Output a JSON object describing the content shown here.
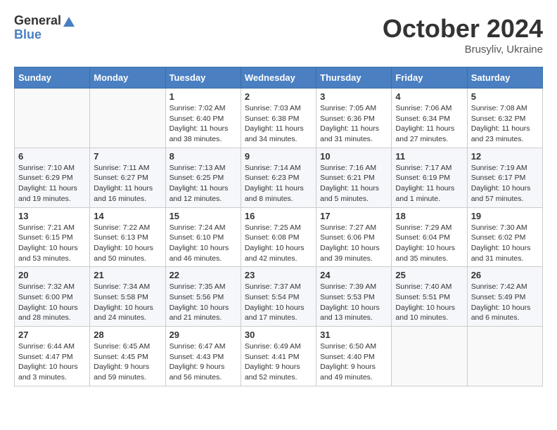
{
  "logo": {
    "general": "General",
    "blue": "Blue"
  },
  "title": {
    "month": "October 2024",
    "location": "Brusyliv, Ukraine"
  },
  "headers": [
    "Sunday",
    "Monday",
    "Tuesday",
    "Wednesday",
    "Thursday",
    "Friday",
    "Saturday"
  ],
  "weeks": [
    [
      {
        "day": "",
        "info": ""
      },
      {
        "day": "",
        "info": ""
      },
      {
        "day": "1",
        "info": "Sunrise: 7:02 AM\nSunset: 6:40 PM\nDaylight: 11 hours and 38 minutes."
      },
      {
        "day": "2",
        "info": "Sunrise: 7:03 AM\nSunset: 6:38 PM\nDaylight: 11 hours and 34 minutes."
      },
      {
        "day": "3",
        "info": "Sunrise: 7:05 AM\nSunset: 6:36 PM\nDaylight: 11 hours and 31 minutes."
      },
      {
        "day": "4",
        "info": "Sunrise: 7:06 AM\nSunset: 6:34 PM\nDaylight: 11 hours and 27 minutes."
      },
      {
        "day": "5",
        "info": "Sunrise: 7:08 AM\nSunset: 6:32 PM\nDaylight: 11 hours and 23 minutes."
      }
    ],
    [
      {
        "day": "6",
        "info": "Sunrise: 7:10 AM\nSunset: 6:29 PM\nDaylight: 11 hours and 19 minutes."
      },
      {
        "day": "7",
        "info": "Sunrise: 7:11 AM\nSunset: 6:27 PM\nDaylight: 11 hours and 16 minutes."
      },
      {
        "day": "8",
        "info": "Sunrise: 7:13 AM\nSunset: 6:25 PM\nDaylight: 11 hours and 12 minutes."
      },
      {
        "day": "9",
        "info": "Sunrise: 7:14 AM\nSunset: 6:23 PM\nDaylight: 11 hours and 8 minutes."
      },
      {
        "day": "10",
        "info": "Sunrise: 7:16 AM\nSunset: 6:21 PM\nDaylight: 11 hours and 5 minutes."
      },
      {
        "day": "11",
        "info": "Sunrise: 7:17 AM\nSunset: 6:19 PM\nDaylight: 11 hours and 1 minute."
      },
      {
        "day": "12",
        "info": "Sunrise: 7:19 AM\nSunset: 6:17 PM\nDaylight: 10 hours and 57 minutes."
      }
    ],
    [
      {
        "day": "13",
        "info": "Sunrise: 7:21 AM\nSunset: 6:15 PM\nDaylight: 10 hours and 53 minutes."
      },
      {
        "day": "14",
        "info": "Sunrise: 7:22 AM\nSunset: 6:13 PM\nDaylight: 10 hours and 50 minutes."
      },
      {
        "day": "15",
        "info": "Sunrise: 7:24 AM\nSunset: 6:10 PM\nDaylight: 10 hours and 46 minutes."
      },
      {
        "day": "16",
        "info": "Sunrise: 7:25 AM\nSunset: 6:08 PM\nDaylight: 10 hours and 42 minutes."
      },
      {
        "day": "17",
        "info": "Sunrise: 7:27 AM\nSunset: 6:06 PM\nDaylight: 10 hours and 39 minutes."
      },
      {
        "day": "18",
        "info": "Sunrise: 7:29 AM\nSunset: 6:04 PM\nDaylight: 10 hours and 35 minutes."
      },
      {
        "day": "19",
        "info": "Sunrise: 7:30 AM\nSunset: 6:02 PM\nDaylight: 10 hours and 31 minutes."
      }
    ],
    [
      {
        "day": "20",
        "info": "Sunrise: 7:32 AM\nSunset: 6:00 PM\nDaylight: 10 hours and 28 minutes."
      },
      {
        "day": "21",
        "info": "Sunrise: 7:34 AM\nSunset: 5:58 PM\nDaylight: 10 hours and 24 minutes."
      },
      {
        "day": "22",
        "info": "Sunrise: 7:35 AM\nSunset: 5:56 PM\nDaylight: 10 hours and 21 minutes."
      },
      {
        "day": "23",
        "info": "Sunrise: 7:37 AM\nSunset: 5:54 PM\nDaylight: 10 hours and 17 minutes."
      },
      {
        "day": "24",
        "info": "Sunrise: 7:39 AM\nSunset: 5:53 PM\nDaylight: 10 hours and 13 minutes."
      },
      {
        "day": "25",
        "info": "Sunrise: 7:40 AM\nSunset: 5:51 PM\nDaylight: 10 hours and 10 minutes."
      },
      {
        "day": "26",
        "info": "Sunrise: 7:42 AM\nSunset: 5:49 PM\nDaylight: 10 hours and 6 minutes."
      }
    ],
    [
      {
        "day": "27",
        "info": "Sunrise: 6:44 AM\nSunset: 4:47 PM\nDaylight: 10 hours and 3 minutes."
      },
      {
        "day": "28",
        "info": "Sunrise: 6:45 AM\nSunset: 4:45 PM\nDaylight: 9 hours and 59 minutes."
      },
      {
        "day": "29",
        "info": "Sunrise: 6:47 AM\nSunset: 4:43 PM\nDaylight: 9 hours and 56 minutes."
      },
      {
        "day": "30",
        "info": "Sunrise: 6:49 AM\nSunset: 4:41 PM\nDaylight: 9 hours and 52 minutes."
      },
      {
        "day": "31",
        "info": "Sunrise: 6:50 AM\nSunset: 4:40 PM\nDaylight: 9 hours and 49 minutes."
      },
      {
        "day": "",
        "info": ""
      },
      {
        "day": "",
        "info": ""
      }
    ]
  ]
}
